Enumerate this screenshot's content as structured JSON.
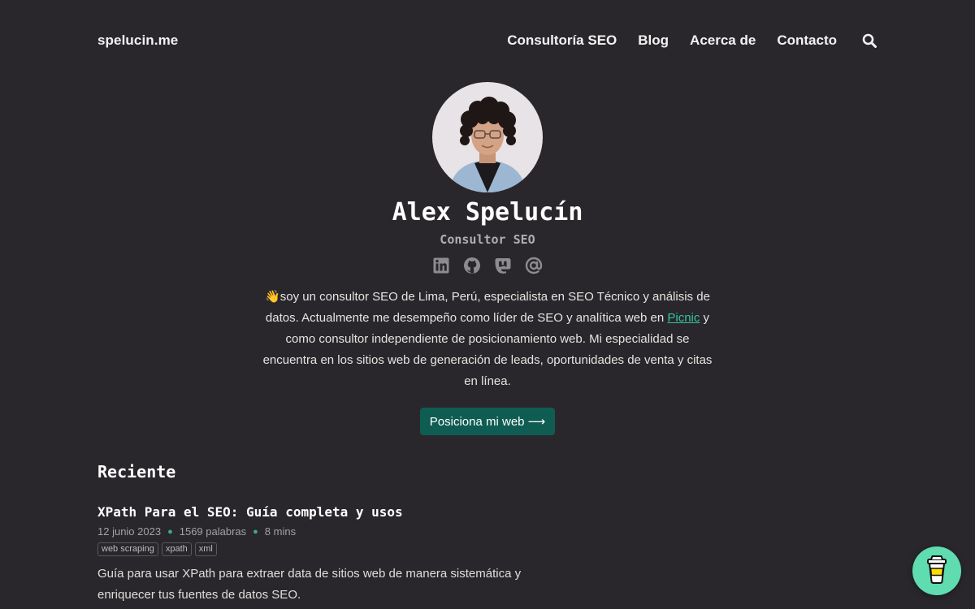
{
  "header": {
    "site_title": "spelucin.me",
    "nav": [
      {
        "label": "Consultoría SEO"
      },
      {
        "label": "Blog"
      },
      {
        "label": "Acerca de"
      },
      {
        "label": "Contacto"
      }
    ],
    "search_icon": "search-icon"
  },
  "profile": {
    "name": "Alex Spelucín",
    "subtitle": "Consultor SEO",
    "social": [
      "linkedin-icon",
      "github-icon",
      "mastodon-icon",
      "email-icon"
    ],
    "bio_emoji": "👋",
    "bio_before_link": "soy un consultor SEO de Lima, Perú, especialista en SEO Técnico y análisis de datos. Actualmente me desempeño como líder de SEO y analítica web en ",
    "bio_link": "Picnic",
    "bio_after_link": " y como consultor independiente de posicionamiento web. Mi especialidad se encuentra en los sitios web de generación de leads, oportunidades de venta y citas en línea.",
    "cta_label": "Posiciona mi web ⟶"
  },
  "recent": {
    "heading": "Reciente",
    "posts": [
      {
        "title": "XPath Para el SEO: Guía completa y usos",
        "date": "12 junio 2023",
        "words": "1569 palabras",
        "reading_time": "8 mins",
        "tags": [
          "web scraping",
          "xpath",
          "xml"
        ],
        "description": "Guía para usar XPath para extraer data de sitios web de manera sistemática y enriquecer tus fuentes de datos SEO."
      }
    ]
  },
  "floating": {
    "icon": "coffee-cup-icon"
  },
  "colors": {
    "background": "#29272b",
    "accent": "#35c3a0",
    "cta_bg": "#0f5c52",
    "coffee_bg": "#5fdcb0"
  }
}
